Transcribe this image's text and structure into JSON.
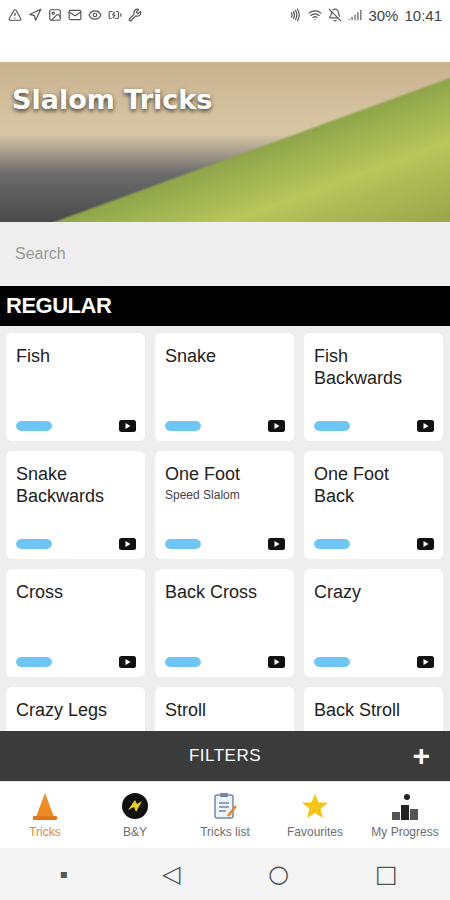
{
  "status_bar": {
    "battery": "30%",
    "time": "10:41"
  },
  "header": {
    "title": "Slalom Tricks"
  },
  "search": {
    "placeholder": "Search"
  },
  "section": {
    "title": "REGULAR"
  },
  "tricks": [
    {
      "name": "Fish",
      "level": 1
    },
    {
      "name": "Snake",
      "level": 1
    },
    {
      "name": "Fish Backwards",
      "level": 1
    },
    {
      "name": "Snake Backwards",
      "level": 1
    },
    {
      "name": "One Foot",
      "subtitle": "Speed Slalom",
      "level": 1
    },
    {
      "name": "One Foot Back",
      "level": 1
    },
    {
      "name": "Cross",
      "level": 1
    },
    {
      "name": "Back Cross",
      "level": 1
    },
    {
      "name": "Crazy",
      "level": 1
    },
    {
      "name": "Crazy Legs",
      "level": 1
    },
    {
      "name": "Stroll",
      "level": 1
    },
    {
      "name": "Back Stroll",
      "level": 1
    }
  ],
  "filters": {
    "label": "FILTERS",
    "add": "+"
  },
  "nav": [
    {
      "label": "Tricks",
      "selected": true
    },
    {
      "label": "B&Y",
      "selected": false
    },
    {
      "label": "Tricks list",
      "selected": false
    },
    {
      "label": "Favourites",
      "selected": false
    },
    {
      "label": "My Progress",
      "selected": false
    }
  ],
  "system_nav": [
    "▪",
    "◁",
    "○",
    "□"
  ]
}
